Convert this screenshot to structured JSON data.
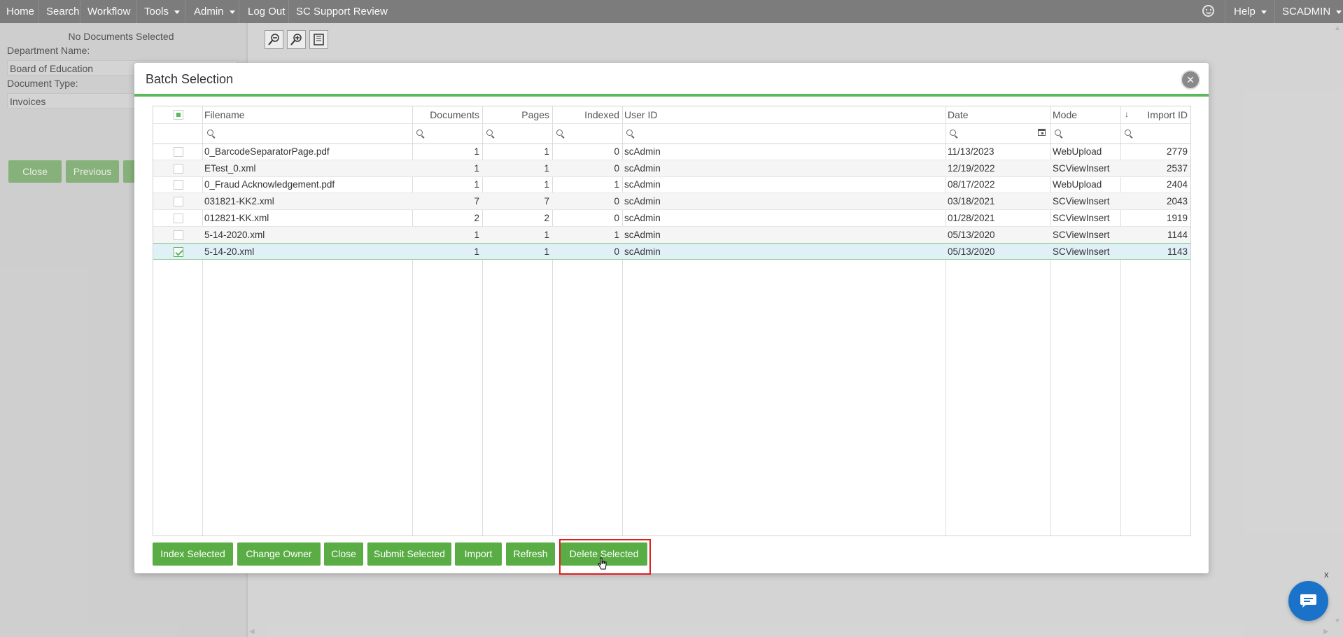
{
  "nav": {
    "items": [
      {
        "label": "Home"
      },
      {
        "label": "Search"
      },
      {
        "label": "Workflow"
      },
      {
        "label": "Tools"
      },
      {
        "label": "Admin"
      },
      {
        "label": "Log Out"
      },
      {
        "label": "SC Support Review"
      }
    ],
    "help": "Help",
    "user": "SCADMIN",
    "bg_color": "#7f7f7f"
  },
  "left_panel": {
    "status": "No Documents Selected",
    "department_label": "Department Name:",
    "department_value": "Board of Education",
    "doctype_label": "Document Type:",
    "doctype_value": "Invoices",
    "buttons": [
      "Close",
      "Previous"
    ]
  },
  "modal": {
    "title": "Batch Selection",
    "close_glyph": "×",
    "accent_color": "#5cb85c",
    "columns": [
      "Filename",
      "Documents",
      "Pages",
      "Indexed",
      "User ID",
      "Date",
      "Mode",
      "Import ID"
    ],
    "rows": [
      {
        "filename": "0_BarcodeSeparatorPage.pdf",
        "documents": "1",
        "pages": "1",
        "indexed": "0",
        "user": "scAdmin",
        "date": "11/13/2023",
        "mode": "WebUpload",
        "import_id": "2779",
        "checked": false
      },
      {
        "filename": "ETest_0.xml",
        "documents": "1",
        "pages": "1",
        "indexed": "0",
        "user": "scAdmin",
        "date": "12/19/2022",
        "mode": "SCViewInsert",
        "import_id": "2537",
        "checked": false
      },
      {
        "filename": "0_Fraud Acknowledgement.pdf",
        "documents": "1",
        "pages": "1",
        "indexed": "1",
        "user": "scAdmin",
        "date": "08/17/2022",
        "mode": "WebUpload",
        "import_id": "2404",
        "checked": false
      },
      {
        "filename": "031821-KK2.xml",
        "documents": "7",
        "pages": "7",
        "indexed": "0",
        "user": "scAdmin",
        "date": "03/18/2021",
        "mode": "SCViewInsert",
        "import_id": "2043",
        "checked": false
      },
      {
        "filename": "012821-KK.xml",
        "documents": "2",
        "pages": "2",
        "indexed": "0",
        "user": "scAdmin",
        "date": "01/28/2021",
        "mode": "SCViewInsert",
        "import_id": "1919",
        "checked": false
      },
      {
        "filename": "5-14-2020.xml",
        "documents": "1",
        "pages": "1",
        "indexed": "1",
        "user": "scAdmin",
        "date": "05/13/2020",
        "mode": "SCViewInsert",
        "import_id": "1144",
        "checked": false
      },
      {
        "filename": "5-14-20.xml",
        "documents": "1",
        "pages": "1",
        "indexed": "0",
        "user": "scAdmin",
        "date": "05/13/2020",
        "mode": "SCViewInsert",
        "import_id": "1143",
        "checked": true
      }
    ],
    "buttons": [
      "Index Selected",
      "Change Owner",
      "Close",
      "Submit Selected",
      "Import",
      "Refresh",
      "Delete Selected"
    ],
    "button_color": "#5aac45"
  },
  "chat": {
    "close": "x"
  }
}
